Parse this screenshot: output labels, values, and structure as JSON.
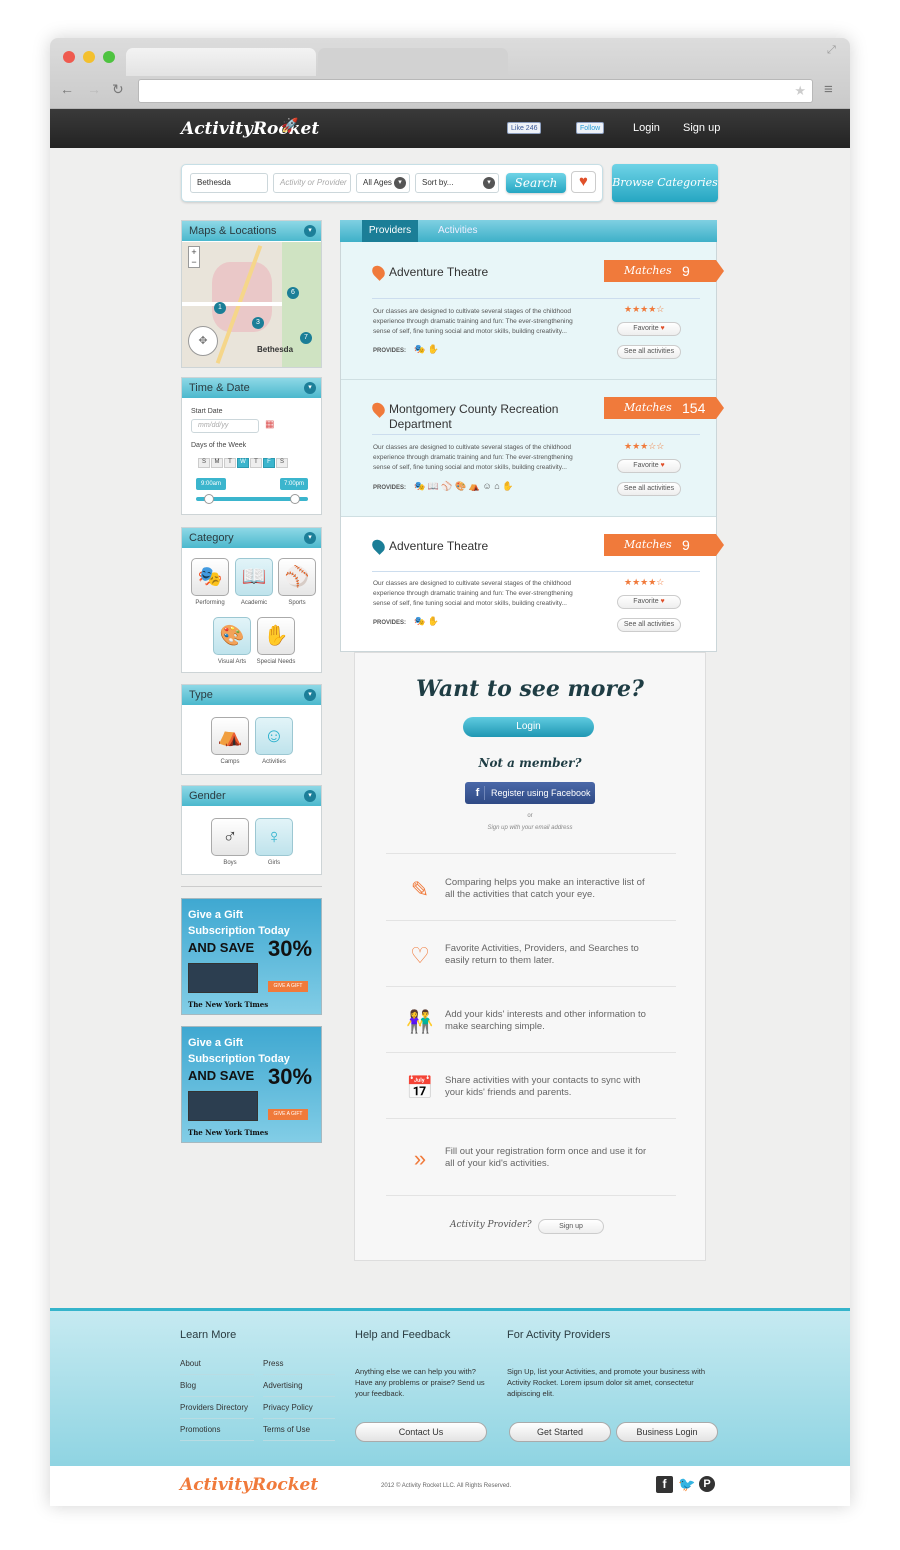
{
  "brand": {
    "name": "ActivityRocket"
  },
  "topnav": {
    "fb_like": "Like",
    "fb_count": "246",
    "twitter": "Follow",
    "login": "Login",
    "signup": "Sign up"
  },
  "search": {
    "location": "Bethesda",
    "activity_placeholder": "Activity or Provider",
    "ages": "All Ages",
    "sort": "Sort by...",
    "button": "Search",
    "browse": "Browse Categories"
  },
  "sidebar": {
    "maps": {
      "title": "Maps & Locations",
      "city": "Bethesda"
    },
    "time": {
      "title": "Time & Date",
      "start_label": "Start Date",
      "date_placeholder": "mm/dd/yy",
      "days_label": "Days of the Week",
      "days": [
        "S",
        "M",
        "T",
        "W",
        "T",
        "F",
        "S"
      ],
      "time_from": "9:00am",
      "time_to": "7:00pm"
    },
    "category": {
      "title": "Category",
      "items": [
        "Performing",
        "Academic",
        "Sports",
        "Visual Arts",
        "Special Needs"
      ]
    },
    "type": {
      "title": "Type",
      "items": [
        "Camps",
        "Activities"
      ]
    },
    "gender": {
      "title": "Gender",
      "items": [
        "Boys",
        "Girls"
      ]
    },
    "ad": {
      "line1": "Give a Gift",
      "line2": "Subscription Today",
      "line3": "AND SAVE",
      "pct": "30%",
      "cta": "GIVE A GIFT",
      "paper": "The New York Times"
    }
  },
  "tabs": [
    "Providers",
    "Activities"
  ],
  "results": [
    {
      "marker": "A",
      "name": "Adventure Theatre",
      "matches_label": "Matches",
      "count": "9",
      "desc": "Our classes are designed to cultivate several stages of the childhood experience through dramatic training and fun: The ever-strengthening sense of self, fine tuning social and motor skills, building creativity...",
      "provides": "PROVIDES:",
      "stars": "★★★★☆",
      "favorite": "Favorite",
      "see_all": "See all activities"
    },
    {
      "marker": "B",
      "name": "Montgomery County Recreation Department",
      "matches_label": "Matches",
      "count": "154",
      "desc": "Our classes are designed to cultivate several stages of the childhood experience through dramatic training and fun: The ever-strengthening sense of self, fine tuning social and motor skills, building creativity...",
      "provides": "PROVIDES:",
      "stars": "★★★☆☆",
      "favorite": "Favorite",
      "see_all": "See all activities"
    },
    {
      "marker": "C",
      "name": "Adventure Theatre",
      "matches_label": "Matches",
      "count": "9",
      "desc": "Our classes are designed to cultivate several stages of the childhood experience through dramatic training and fun: The ever-strengthening sense of self, fine tuning social and motor skills, building creativity...",
      "provides": "PROVIDES:",
      "stars": "★★★★☆",
      "favorite": "Favorite",
      "see_all": "See all activities"
    }
  ],
  "more": {
    "headline": "Want to see more?",
    "login": "Login",
    "not_member": "Not a member?",
    "fb_register": "Register using Facebook",
    "or": "or",
    "email_signup": "Sign up with your email address",
    "features": [
      "Comparing helps you make an interactive list of all the activities that catch your eye.",
      "Favorite Activities, Providers, and Searches to easily return to them later.",
      "Add your kids' interests and other information to make searching simple.",
      "Share activities with your contacts to sync with your kids' friends and parents.",
      "Fill out your registration form once and use it for all of your kid's activities."
    ],
    "provider_q": "Activity Provider?",
    "provider_signup": "Sign up"
  },
  "footer": {
    "learn": {
      "title": "Learn More",
      "col1": [
        "About",
        "Blog",
        "Providers Directory",
        "Promotions"
      ],
      "col2": [
        "Press",
        "Advertising",
        "Privacy Policy",
        "Terms of Use"
      ]
    },
    "help": {
      "title": "Help and Feedback",
      "text": "Anything else we can help you with? Have any problems or praise? Send us your feedback.",
      "button": "Contact Us"
    },
    "providers": {
      "title": "For Activity Providers",
      "text": "Sign Up, list your Activities, and promote your business with Activity Rocket. Lorem ipsum dolor sit amet, consectetur adipiscing elit.",
      "button1": "Get Started",
      "button2": "Business Login"
    },
    "copyright": "2012 © Activity Rocket LLC. All Rights Reserved."
  },
  "colors": {
    "accent": "#35b4cb",
    "orange": "#f07a3b",
    "dark": "#2b2b2b"
  }
}
